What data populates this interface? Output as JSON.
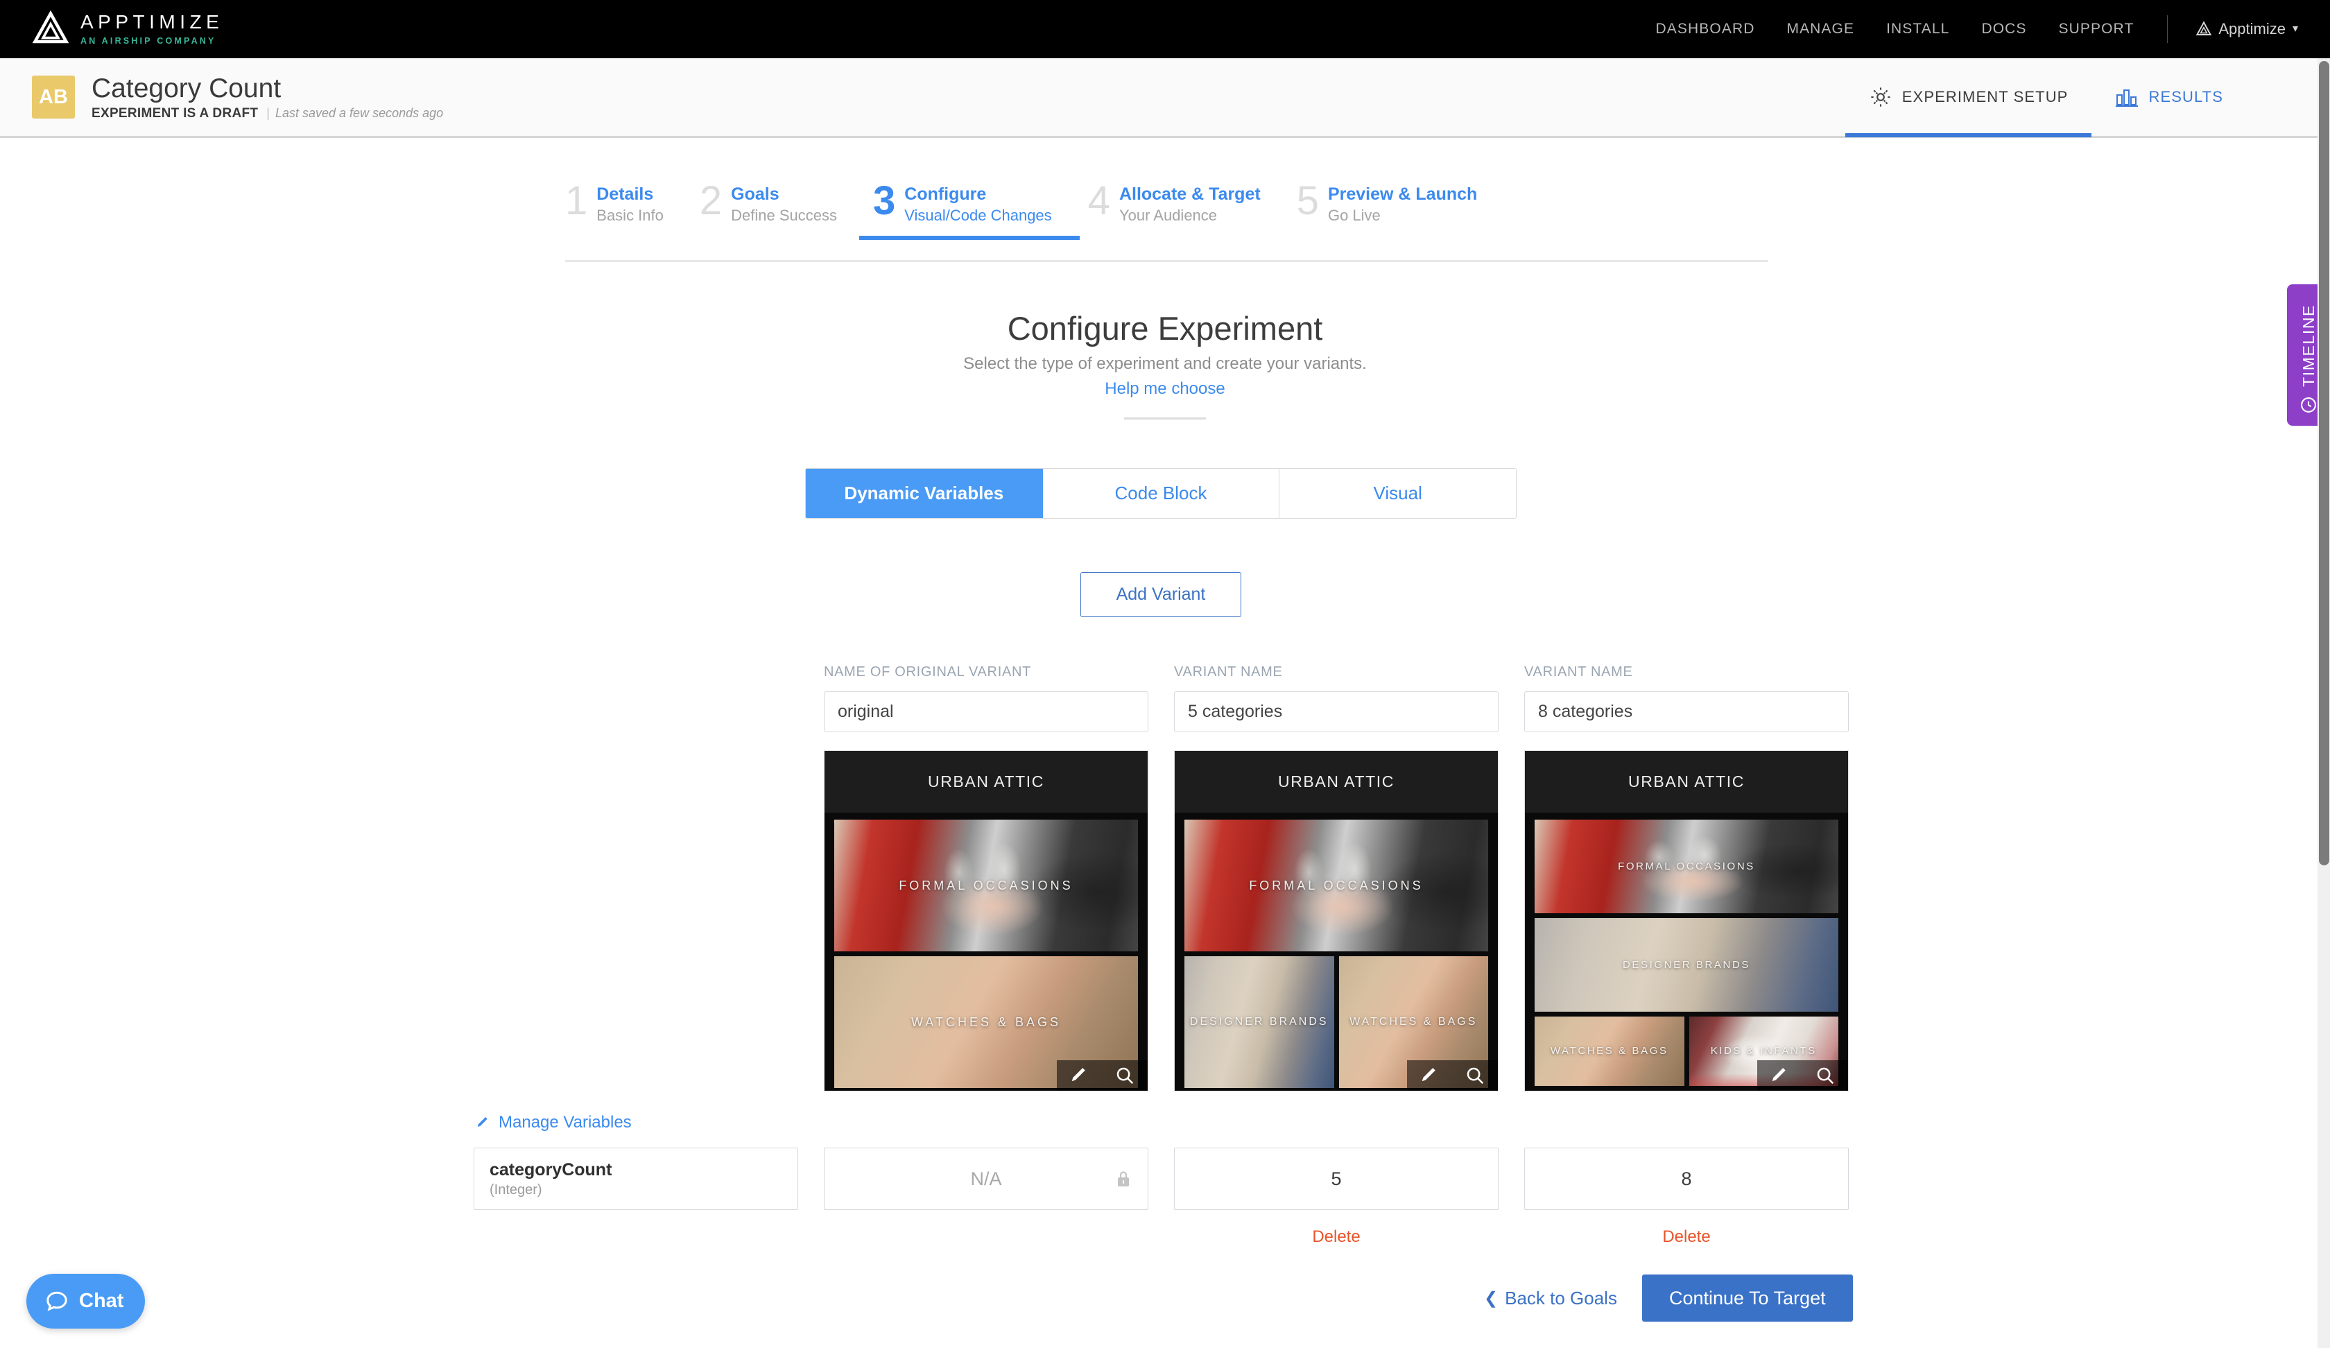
{
  "topnav": {
    "brand_name": "APPTIMIZE",
    "brand_sub": "AN AIRSHIP COMPANY",
    "links": [
      "DASHBOARD",
      "MANAGE",
      "INSTALL",
      "DOCS",
      "SUPPORT"
    ],
    "account_label": "Apptimize",
    "account_caret": "▾",
    "logo_icon": "apptimize-triangle-logo"
  },
  "subheader": {
    "badge": "AB",
    "title": "Category Count",
    "status": "EXPERIMENT IS A DRAFT",
    "saved": "Last saved a few seconds ago",
    "tabs": [
      {
        "label": "EXPERIMENT SETUP",
        "icon": "gear-icon",
        "active": true
      },
      {
        "label": "RESULTS",
        "icon": "bar-chart-icon",
        "active": false
      }
    ]
  },
  "wizard": {
    "steps": [
      {
        "num": "1",
        "title": "Details",
        "sub": "Basic Info",
        "current": false
      },
      {
        "num": "2",
        "title": "Goals",
        "sub": "Define Success",
        "current": false
      },
      {
        "num": "3",
        "title": "Configure",
        "sub": "Visual/Code Changes",
        "current": true
      },
      {
        "num": "4",
        "title": "Allocate & Target",
        "sub": "Your Audience",
        "current": false
      },
      {
        "num": "5",
        "title": "Preview & Launch",
        "sub": "Go Live",
        "current": false
      }
    ]
  },
  "configure": {
    "title": "Configure Experiment",
    "subtitle": "Select the type of experiment and create your variants.",
    "help_link": "Help me choose",
    "type_tabs": [
      {
        "label": "Dynamic Variables",
        "selected": true
      },
      {
        "label": "Code Block",
        "selected": false
      },
      {
        "label": "Visual",
        "selected": false
      }
    ],
    "add_variant_label": "Add Variant"
  },
  "variants": [
    {
      "field_label": "NAME OF ORIGINAL VARIANT",
      "name_value": "original",
      "variable_value": "N/A",
      "locked": true,
      "delete_label": "",
      "preview": {
        "app_title": "URBAN ATTIC",
        "layout": "1-column",
        "tiles": [
          {
            "caption": "FORMAL OCCASIONS",
            "image": "formal-occasions-photo"
          },
          {
            "caption": "WATCHES & BAGS",
            "image": "watches-bags-photo"
          }
        ],
        "tools": [
          "pencil-icon",
          "magnifier-icon"
        ]
      }
    },
    {
      "field_label": "VARIANT NAME",
      "name_value": "5 categories",
      "variable_value": "5",
      "locked": false,
      "delete_label": "Delete",
      "preview": {
        "app_title": "URBAN ATTIC",
        "layout": "mixed",
        "tiles": [
          {
            "caption": "FORMAL OCCASIONS",
            "image": "formal-occasions-photo"
          },
          {
            "caption": "DESIGNER BRANDS",
            "image": "designer-brands-photo"
          },
          {
            "caption": "WATCHES & BAGS",
            "image": "watches-bags-photo"
          }
        ],
        "tools": [
          "pencil-icon",
          "magnifier-icon"
        ]
      }
    },
    {
      "field_label": "VARIANT NAME",
      "name_value": "8 categories",
      "variable_value": "8",
      "locked": false,
      "delete_label": "Delete",
      "preview": {
        "app_title": "URBAN ATTIC",
        "layout": "dense",
        "tiles": [
          {
            "caption": "FORMAL OCCASIONS",
            "image": "formal-occasions-photo"
          },
          {
            "caption": "DESIGNER BRANDS",
            "image": "designer-brands-photo"
          },
          {
            "caption": "WATCHES & BAGS",
            "image": "watches-bags-photo"
          },
          {
            "caption": "KIDS & INFANTS",
            "image": "kids-infants-photo"
          }
        ],
        "tools": [
          "pencil-icon",
          "magnifier-icon"
        ]
      }
    }
  ],
  "variable": {
    "manage_label": "Manage Variables",
    "name": "categoryCount",
    "type": "(Integer)"
  },
  "footer": {
    "back_label": "Back to Goals",
    "back_chevron": "❮",
    "continue_label": "Continue To Target"
  },
  "chat": {
    "label": "Chat",
    "icon": "chat-bubble-icon"
  },
  "timeline": {
    "label": "TIMELINE",
    "icon": "clock-icon"
  },
  "colors": {
    "accent_blue": "#3b8aee",
    "primary_button": "#3a72c8",
    "delete_red": "#e8542a",
    "timeline_purple": "#8e3fc8",
    "badge_yellow": "#e9c96a",
    "brand_teal": "#39b79a"
  }
}
